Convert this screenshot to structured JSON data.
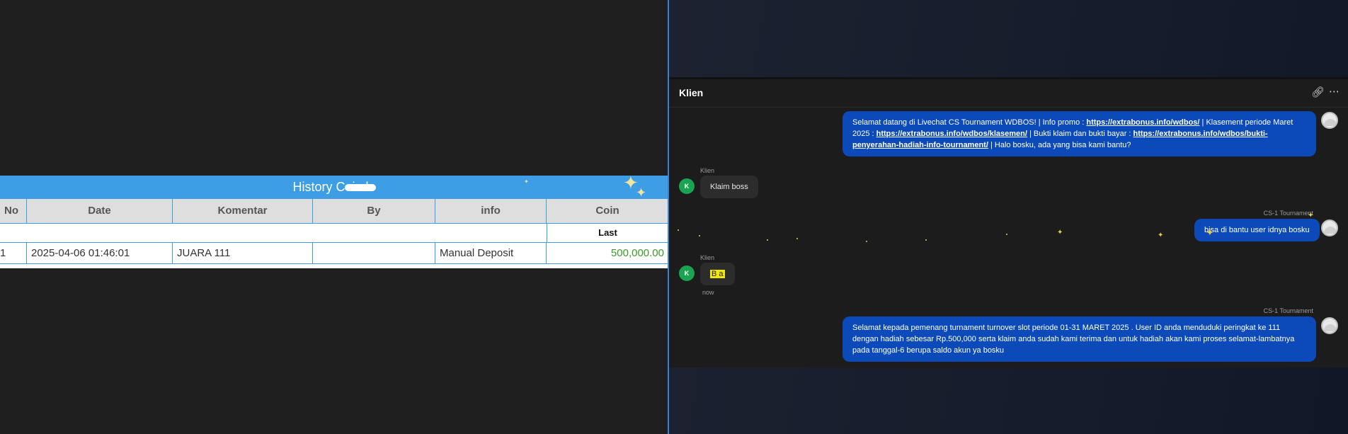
{
  "history": {
    "title": "History Coin b",
    "columns": [
      "No",
      "Date",
      "Komentar",
      "By",
      "info",
      "Coin"
    ],
    "sub_header": "Last",
    "rows": [
      {
        "no": "1",
        "date": "2025-04-06 01:46:01",
        "komentar": "JUARA 111",
        "by": "",
        "info": "Manual Deposit",
        "coin": "500,000.00"
      }
    ]
  },
  "chat": {
    "title": "Klien",
    "icons": {
      "link": "link-icon",
      "more": "more-icon"
    },
    "messages": [
      {
        "direction": "out",
        "sender": "",
        "parts": [
          {
            "text": "Selamat datang di Livechat CS Tournament WDBOS! | Info promo : "
          },
          {
            "link": "https://extrabonus.info/wdbos/"
          },
          {
            "text": " | Klasement periode Maret 2025 : "
          },
          {
            "link": "https://extrabonus.info/wdbos/klasemen/"
          },
          {
            "text": " | Bukti klaim dan bukti bayar : "
          },
          {
            "link": "https://extrabonus.info/wdbos/bukti-penyerahan-hadiah-info-tournament/"
          },
          {
            "text": " | Halo bosku, ada yang bisa kami bantu?"
          }
        ]
      },
      {
        "direction": "in",
        "sender": "Klien",
        "avatar": "K",
        "text": "Klaim boss"
      },
      {
        "direction": "out",
        "sender": "CS-1 Tournament",
        "text": "bisa di bantu user idnya bosku"
      },
      {
        "direction": "in",
        "sender": "Klien",
        "avatar": "K",
        "text": "B       a",
        "time": "now"
      },
      {
        "direction": "out",
        "sender": "CS-1 Tournament",
        "text": "Selamat kepada pemenang turnament turnover slot periode 01-31 MARET 2025 . User ID anda menduduki peringkat ke 111 dengan hadiah sebesar Rp.500,000 serta klaim anda sudah kami terima dan untuk hadiah akan kami proses selamat-lambatnya pada tanggal-6 berupa saldo akun ya bosku"
      }
    ]
  },
  "colors": {
    "accent_blue": "#3d9ee6",
    "bubble_out": "#0b4ab8",
    "coin_green": "#3a9a2a",
    "avatar_green": "#1aa350",
    "highlight": "#f2e60a"
  }
}
